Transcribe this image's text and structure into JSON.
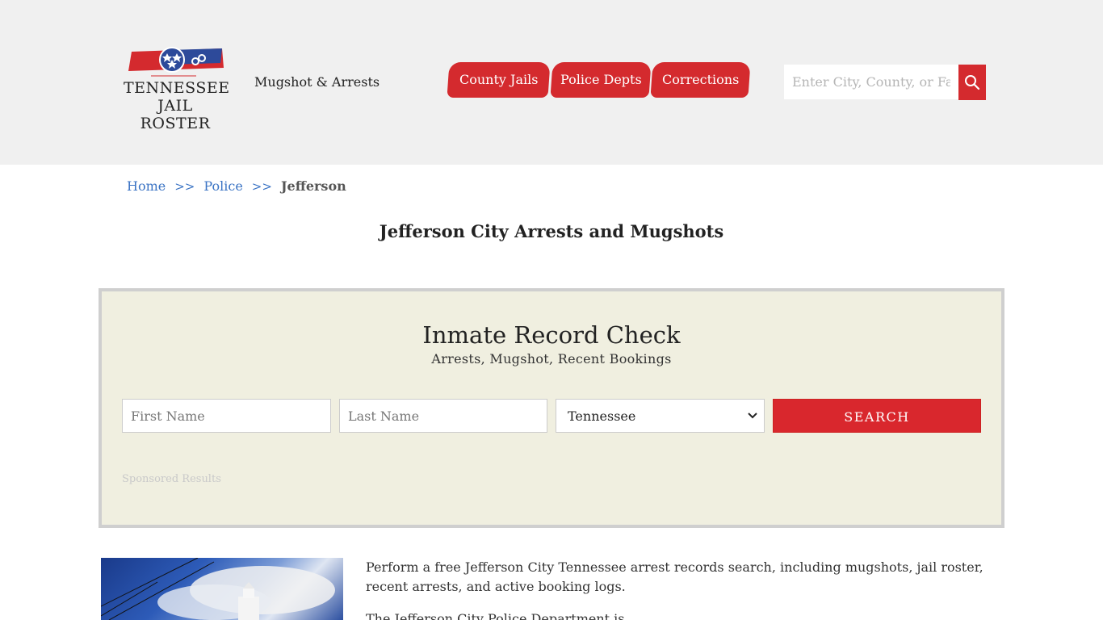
{
  "header": {
    "logo_line1": "TENNESSEE",
    "logo_line2": "JAIL ROSTER",
    "tagline": "Mugshot & Arrests",
    "nav": [
      {
        "label": "County Jails"
      },
      {
        "label": "Police Depts"
      },
      {
        "label": "Corrections"
      }
    ],
    "search_placeholder": "Enter City, County, or Facility"
  },
  "breadcrumb": {
    "home": "Home",
    "sep": ">>",
    "police": "Police",
    "current": "Jefferson"
  },
  "page_title": "Jefferson City Arrests and Mugshots",
  "record_check": {
    "title": "Inmate Record Check",
    "subtitle": "Arrests, Mugshot, Recent Bookings",
    "first_placeholder": "First Name",
    "last_placeholder": "Last Name",
    "state_selected": "Tennessee",
    "search_label": "SEARCH",
    "sponsored": "Sponsored Results"
  },
  "content": {
    "intro": "Perform a free Jefferson City Tennessee arrest records search, including mugshots, jail roster, recent arrests, and active booking logs.",
    "intro2": "The Jefferson City Police Department is ..."
  },
  "colors": {
    "accent": "#d42a2e",
    "header_bg": "#f0f0f0",
    "panel_bg": "#f0efe0",
    "link": "#3a73c4"
  }
}
